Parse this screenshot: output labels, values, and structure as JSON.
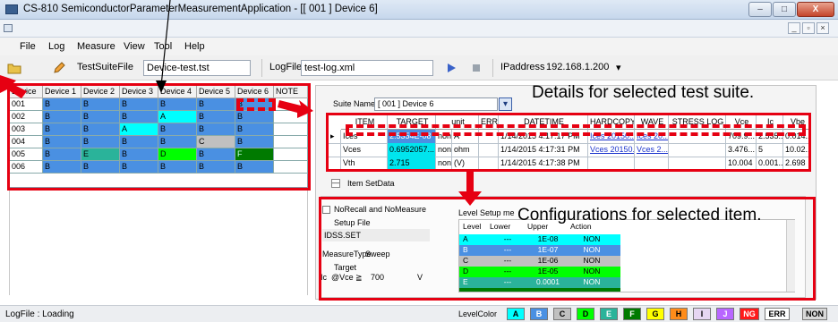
{
  "window": {
    "title": "CS-810 SemiconductorParameterMeasurementApplication - [[ 001 ] Device 6]",
    "min_glyph": "–",
    "max_glyph": "□",
    "close_glyph": "X"
  },
  "mdi": {
    "min_glyph": "_",
    "restore_glyph": "▫",
    "close_glyph": "×"
  },
  "menu": [
    "File",
    "Log",
    "Measure",
    "View",
    "Tool",
    "Help"
  ],
  "toolbar": {
    "testsuite_label": "TestSuiteFile",
    "testsuite_value": "Device-test.tst",
    "logfile_label": "LogFile",
    "logfile_value": "test-log.xml",
    "ipaddress_label": "IPaddress",
    "ipaddress_value": "192.168.1.200",
    "dropdown_glyph": "▾"
  },
  "device_grid": {
    "headers": [
      "Device",
      "Device 1",
      "Device 2",
      "Device 3",
      "Device 4",
      "Device 5",
      "Device 6",
      "NOTE"
    ],
    "rows": [
      {
        "id": "001",
        "cells": [
          "B",
          "B",
          "B",
          "B",
          "B",
          "B"
        ]
      },
      {
        "id": "002",
        "cells": [
          "B",
          "B",
          "B",
          "A",
          "B",
          "B"
        ]
      },
      {
        "id": "003",
        "cells": [
          "B",
          "B",
          "A",
          "B",
          "B",
          "B"
        ]
      },
      {
        "id": "004",
        "cells": [
          "B",
          "B",
          "B",
          "B",
          "C",
          "B"
        ]
      },
      {
        "id": "005",
        "cells": [
          "B",
          "E",
          "B",
          "D",
          "B",
          "F"
        ]
      },
      {
        "id": "006",
        "cells": [
          "B",
          "B",
          "B",
          "B",
          "B",
          "B"
        ]
      }
    ]
  },
  "suite": {
    "label": "Suite Name",
    "value": "[ 001 ] Device 6",
    "dropdown_glyph": "▾"
  },
  "result_table": {
    "headers": [
      "ITEM",
      "TARGET",
      "unit",
      "ERR",
      "DATETIME",
      "HARDCOPY",
      "WAVE",
      "STRESS LOG",
      "Vce",
      "Ic",
      "Vbe"
    ],
    "rows": [
      {
        "marker": "▸",
        "item": "Ices",
        "target": "2.5354E-08",
        "unit_a": "non",
        "unit_b": "A",
        "err": "",
        "datetime": "1/14/2015 4:17:17 PM",
        "hardcopy": "Ices 20150...",
        "wave": "Ices 20...",
        "stress": "",
        "vce": "709.9...",
        "ic": "2.535...",
        "vbe": "0.014..."
      },
      {
        "marker": "",
        "item": "Vces",
        "target": "0.6952057...",
        "unit_a": "non",
        "unit_b": "ohm",
        "err": "",
        "datetime": "1/14/2015 4:17:31 PM",
        "hardcopy": "Vces 20150...",
        "wave": "Vces 2...",
        "stress": "",
        "vce": "3.476...",
        "ic": "5",
        "vbe": "10.02..."
      },
      {
        "marker": "",
        "item": "Vth",
        "target": "2.715",
        "unit_a": "non",
        "unit_b": "(V)",
        "err": "",
        "datetime": "1/14/2015 4:17:38 PM",
        "hardcopy": "",
        "wave": "",
        "stress": "",
        "vce": "10.004",
        "ic": "0.001...",
        "vbe": "2.698"
      }
    ]
  },
  "item_setdata": {
    "toggle_glyph": "—",
    "label": "Item SetData"
  },
  "config": {
    "norecall_label": "NoRecall and NoMeasure",
    "setup_file_label": "Setup File",
    "setup_file_value": "IDSS.SET",
    "measure_type_label": "MeasureType",
    "measure_type_value": "Sweep",
    "target_label": "Target",
    "target_symbol": "Ic",
    "target_condition": "@Vce",
    "target_operator": "≧",
    "target_value": "700",
    "target_unit": "V",
    "level_setup_label": "Level Setup",
    "level_setup_suffix": "me",
    "level_headers": [
      "Level",
      "Lower",
      "Upper",
      "Action"
    ],
    "levels": [
      {
        "level": "A",
        "lower": "---",
        "upper": "1E-08",
        "action": "NON"
      },
      {
        "level": "B",
        "lower": "---",
        "upper": "1E-07",
        "action": "NON"
      },
      {
        "level": "C",
        "lower": "---",
        "upper": "1E-06",
        "action": "NON"
      },
      {
        "level": "D",
        "lower": "---",
        "upper": "1E-05",
        "action": "NON"
      },
      {
        "level": "E",
        "lower": "---",
        "upper": "0.0001",
        "action": "NON"
      }
    ]
  },
  "status": {
    "logfile_text": "LogFile : Loading",
    "levelcolor_label": "LevelColor",
    "chips": [
      "A",
      "B",
      "C",
      "D",
      "E",
      "F",
      "G",
      "H",
      "I",
      "J",
      "NG",
      "ERR",
      "NON"
    ]
  },
  "callouts": {
    "details": "Details for selected test suite.",
    "configurations": "Configurations for selected item."
  },
  "colors": {
    "A": "#00ffff",
    "B": "#4a90e2",
    "C": "#c0c0c0",
    "D": "#00ff00",
    "E": "#2ab39a",
    "F": "#007a00",
    "G": "#ffff00",
    "H": "#ff8c1a",
    "I": "#e6d6f2",
    "J": "#b866ff",
    "NG": "#ff1a1a",
    "ERR": "#ffffff",
    "NON": "#d8d8d8",
    "annotation": "#e60012"
  }
}
